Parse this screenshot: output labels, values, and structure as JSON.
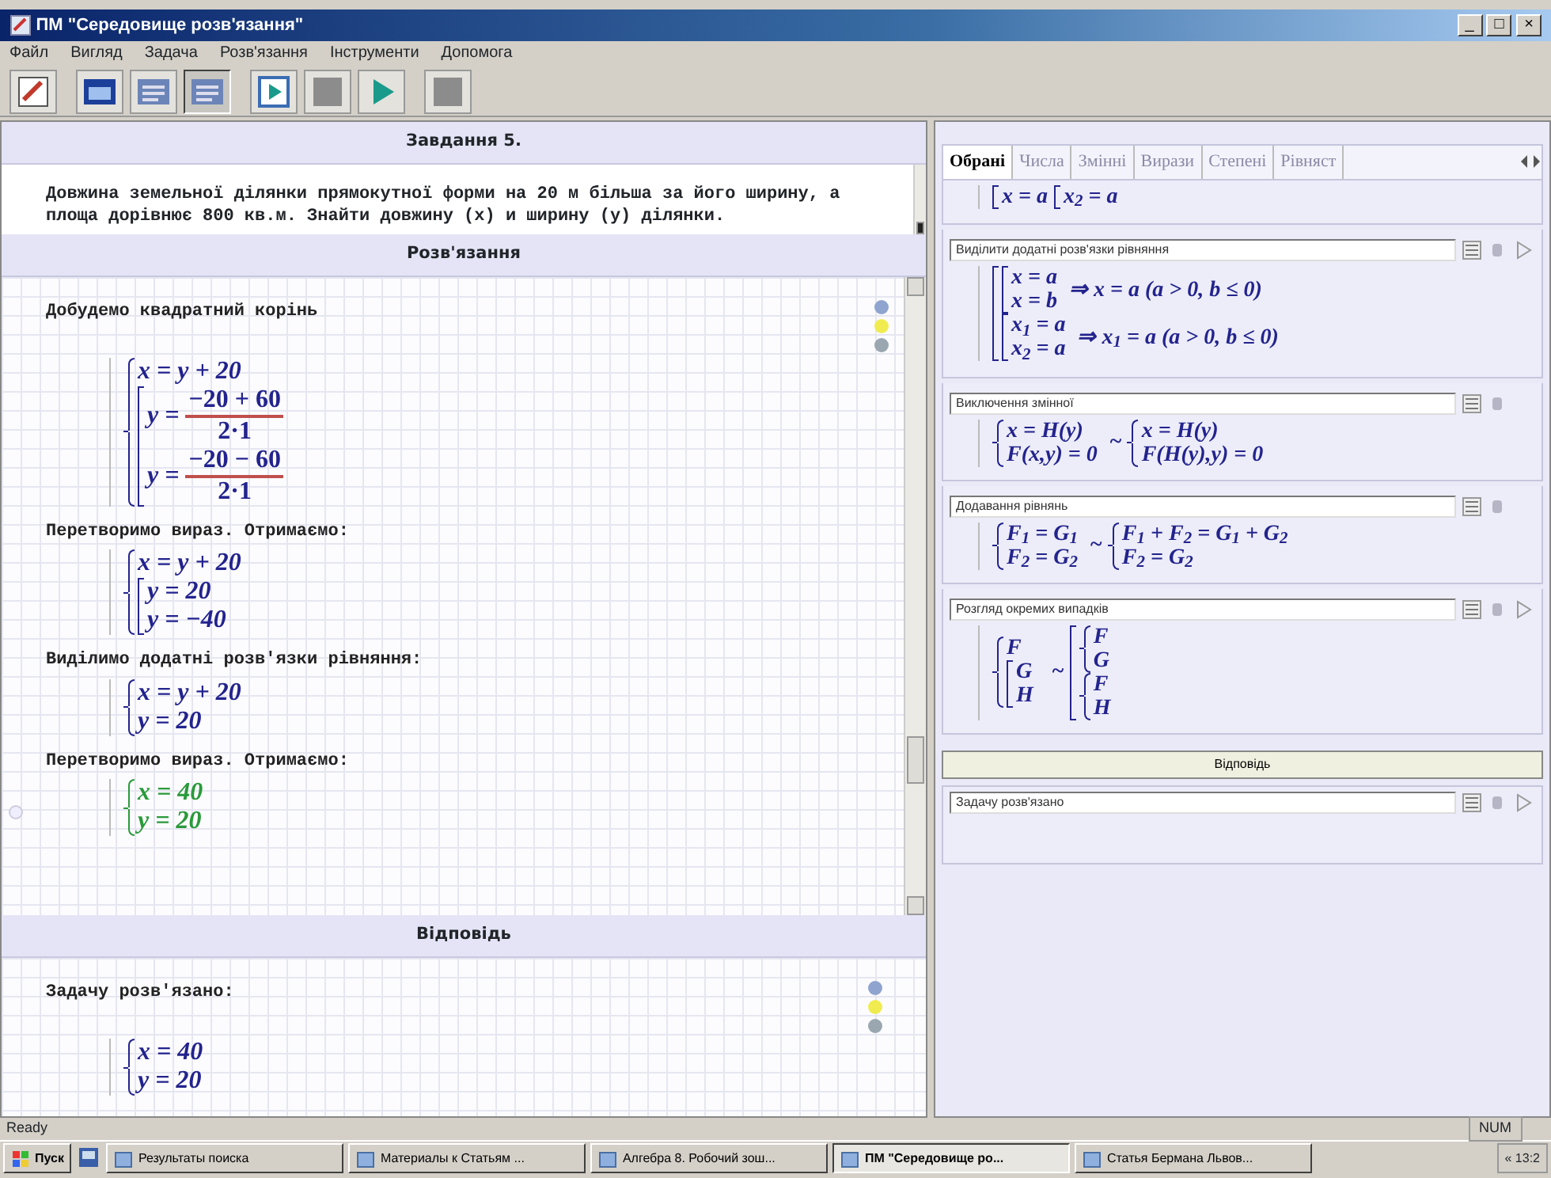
{
  "window": {
    "title": "ПМ \"Середовище розв'язання\"",
    "controls": [
      "_",
      "□",
      "×"
    ]
  },
  "menu": [
    "Файл",
    "Вигляд",
    "Задача",
    "Розв'язання",
    "Інструменти",
    "Допомога"
  ],
  "toolbar": [
    {
      "kind": "pencil",
      "pressed": false
    },
    {
      "kind": "window",
      "pressed": false
    },
    {
      "kind": "list",
      "pressed": false
    },
    {
      "kind": "list",
      "pressed": true
    },
    {
      "kind": "step",
      "pressed": false
    },
    {
      "kind": "square",
      "pressed": false
    },
    {
      "kind": "play",
      "pressed": false
    },
    {
      "kind": "square",
      "pressed": false
    }
  ],
  "task": {
    "title": "Завдання 5.",
    "text": "Довжина земельної ділянки прямокутної форми на 20 м більша за його ширину, а площа дорівнює 800 кв.м. Знайти довжину (x) и ширину (y) ділянки."
  },
  "solution": {
    "title": "Розв'язання",
    "steps": [
      {
        "text": "Добудемо квадратний корінь",
        "color": "#23238e",
        "status_lights": true,
        "marker": false,
        "formula": [
          {
            "kind": "system",
            "rows": [
              [
                {
                  "t": "x = y + 20"
                }
              ],
              [
                {
                  "kind": "union",
                  "rows": [
                    [
                      {
                        "t": "y = "
                      },
                      {
                        "kind": "fraction",
                        "num": "−20 + 60",
                        "den": "2·1"
                      }
                    ],
                    [
                      {
                        "t": "y = "
                      },
                      {
                        "kind": "fraction",
                        "num": "−20 − 60",
                        "den": "2·1"
                      }
                    ]
                  ]
                }
              ]
            ]
          }
        ]
      },
      {
        "text": "Перетворимо вираз. Отримаємо:",
        "color": "#23238e",
        "status_lights": false,
        "marker": false,
        "formula": [
          {
            "kind": "system",
            "rows": [
              [
                {
                  "t": "x = y + 20"
                }
              ],
              [
                {
                  "kind": "union",
                  "rows": [
                    [
                      {
                        "t": "y = 20"
                      }
                    ],
                    [
                      {
                        "t": "y = −40"
                      }
                    ]
                  ]
                }
              ]
            ]
          }
        ]
      },
      {
        "text": "Виділимо додатні розв'язки рівняння:",
        "color": "#23238e",
        "status_lights": false,
        "marker": false,
        "formula": [
          {
            "kind": "system",
            "rows": [
              [
                {
                  "t": "x = y + 20"
                }
              ],
              [
                {
                  "t": "y = 20"
                }
              ]
            ]
          }
        ]
      },
      {
        "text": "Перетворимо вираз. Отримаємо:",
        "color": "#2a9a3a",
        "status_lights": false,
        "marker": true,
        "formula": [
          {
            "kind": "system",
            "rows": [
              [
                {
                  "t": "x = 40"
                }
              ],
              [
                {
                  "t": "y = 20"
                }
              ]
            ]
          }
        ]
      }
    ]
  },
  "answer": {
    "title": "Відповідь",
    "text": "Задачу розв'язано:",
    "status_lights": true,
    "formula": [
      {
        "kind": "system",
        "rows": [
          [
            {
              "t": "x = 40"
            }
          ],
          [
            {
              "t": "y = 20"
            }
          ]
        ]
      }
    ]
  },
  "tabs": [
    {
      "label": "Обрані",
      "selected": true
    },
    {
      "label": "Числа",
      "selected": false
    },
    {
      "label": "Змінні",
      "selected": false
    },
    {
      "label": "Вирази",
      "selected": false
    },
    {
      "label": "Степені",
      "selected": false
    },
    {
      "label": "Рівняст",
      "selected": false
    }
  ],
  "cards": [
    {
      "formula": [
        {
          "kind": "union",
          "rows": [
            [
              {
                "t": "x = a"
              }
            ]
          ]
        },
        {
          "kind": "union",
          "rows": [
            [
              {
                "t": "x$_{2}$ = a"
              }
            ]
          ]
        }
      ]
    },
    {
      "title": "Виділити додатні розв'язки рівняння",
      "play": true,
      "formula": [
        {
          "kind": "union",
          "rows": [
            [
              {
                "kind": "union",
                "rows": [
                  [
                    {
                      "t": "x = a"
                    }
                  ],
                  [
                    {
                      "t": "x = b"
                    }
                  ]
                ]
              },
              {
                "t": " ⇒ x = a (a > 0, b ≤ 0)"
              }
            ],
            [
              {
                "kind": "union",
                "rows": [
                  [
                    {
                      "t": "x$_{1}$ = a"
                    }
                  ],
                  [
                    {
                      "t": "x$_{2}$ = a"
                    }
                  ]
                ]
              },
              {
                "t": " ⇒ x$_{1}$ = a (a > 0, b ≤ 0)"
              }
            ]
          ]
        }
      ]
    },
    {
      "title": "Виключення змінної",
      "play": false,
      "formula": [
        {
          "kind": "system",
          "rows": [
            [
              {
                "t": "x = H(y)"
              }
            ],
            [
              {
                "t": "F(x,y) = 0"
              }
            ]
          ]
        },
        {
          "t": " ~ "
        },
        {
          "kind": "system",
          "rows": [
            [
              {
                "t": "x = H(y)"
              }
            ],
            [
              {
                "t": "F(H(y),y) = 0"
              }
            ]
          ]
        }
      ]
    },
    {
      "title": "Додавання рівнянь",
      "play": false,
      "formula": [
        {
          "kind": "system",
          "rows": [
            [
              {
                "t": "F$_{1}$ = G$_{1}$"
              }
            ],
            [
              {
                "t": "F$_{2}$ = G$_{2}$"
              }
            ]
          ]
        },
        {
          "t": " ~ "
        },
        {
          "kind": "system",
          "rows": [
            [
              {
                "t": "F$_{1}$ + F$_{2}$ = G$_{1}$ + G$_{2}$"
              }
            ],
            [
              {
                "t": "F$_{2}$ = G$_{2}$"
              }
            ]
          ]
        }
      ]
    },
    {
      "title": "Розгляд окремих випадків",
      "play": true,
      "formula": [
        {
          "kind": "system",
          "rows": [
            [
              {
                "t": "F"
              }
            ],
            [
              {
                "kind": "union",
                "rows": [
                  [
                    {
                      "t": "G"
                    }
                  ],
                  [
                    {
                      "t": "H"
                    }
                  ]
                ]
              }
            ]
          ]
        },
        {
          "t": " ~ "
        },
        {
          "kind": "union",
          "rows": [
            [
              {
                "kind": "system",
                "rows": [
                  [
                    {
                      "t": "F"
                    }
                  ],
                  [
                    {
                      "t": "G"
                    }
                  ]
                ]
              }
            ],
            [
              {
                "kind": "system",
                "rows": [
                  [
                    {
                      "t": "F"
                    }
                  ],
                  [
                    {
                      "t": "H"
                    }
                  ]
                ]
              }
            ]
          ]
        }
      ]
    }
  ],
  "answer_button": "Відповідь",
  "answer_card": {
    "title": "Задачу розв'язано",
    "play": true
  },
  "status_bar": {
    "text": "Ready",
    "indicator": "NUM"
  },
  "taskbar": {
    "start": "Пуск",
    "items": [
      {
        "label": "Результаты поиска",
        "selected": false
      },
      {
        "label": "Материалы к Статьям ...",
        "selected": false
      },
      {
        "label": "Алгебра 8. Робочий зош...",
        "selected": false
      },
      {
        "label": "ПМ \"Середовище ро...",
        "selected": true
      },
      {
        "label": "Статья Бермана Львов...",
        "selected": false
      }
    ],
    "clock": "« 13:2"
  }
}
